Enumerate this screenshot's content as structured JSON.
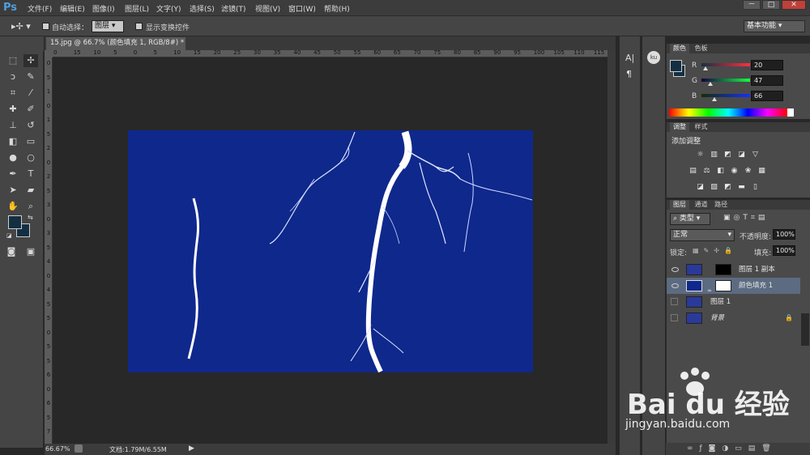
{
  "app": {
    "logo": "Ps"
  },
  "menu": [
    "文件(F)",
    "编辑(E)",
    "图像(I)",
    "图层(L)",
    "文字(Y)",
    "选择(S)",
    "滤镜(T)",
    "视图(V)",
    "窗口(W)",
    "帮助(H)"
  ],
  "window_buttons": [
    "－",
    "□",
    "✕"
  ],
  "options": {
    "auto_select_label": "自动选择：",
    "auto_select_target": "图层",
    "show_transform_label": "显示变换控件",
    "workspace": "基本功能"
  },
  "document": {
    "tab_title": "15.jpg @ 66.7% (颜色填充 1, RGB/8#) *",
    "tab_close": "×",
    "fill_color": "#0f288c"
  },
  "ruler": {
    "h_ticks": [
      "0",
      "15",
      "10",
      "5",
      "0",
      "5",
      "10",
      "15",
      "20",
      "25",
      "30",
      "35",
      "40",
      "45",
      "50",
      "55",
      "60",
      "65",
      "70",
      "75",
      "80",
      "85",
      "90",
      "95",
      "100",
      "105",
      "110",
      "115"
    ],
    "v_ticks": [
      "0",
      "5",
      "1",
      "0",
      "1",
      "5",
      "2",
      "0",
      "2",
      "5",
      "3",
      "0",
      "3",
      "5",
      "4",
      "0",
      "4",
      "5",
      "5",
      "0",
      "5",
      "5",
      "6",
      "0",
      "6",
      "5",
      "7"
    ]
  },
  "status": {
    "zoom": "66.67%",
    "doc_size": "文档:1.79M/6.55M"
  },
  "color_panel": {
    "tabs": [
      "颜色",
      "色板"
    ],
    "r_label": "R",
    "g_label": "G",
    "b_label": "B",
    "r": "20",
    "g": "47",
    "b": "66",
    "r_level": 0.078,
    "g_level": 0.184,
    "b_level": 0.259,
    "swatch": "#142f42"
  },
  "adjustments_panel": {
    "tabs": [
      "调整",
      "样式"
    ],
    "title": "添加调整"
  },
  "layers_panel": {
    "tabs": [
      "图层",
      "通道",
      "路径"
    ],
    "filter_kind": "类型",
    "blend_mode": "正常",
    "opacity_label": "不透明度:",
    "opacity_value": "100%",
    "lock_label": "锁定:",
    "fill_label": "填充:",
    "fill_value": "100%",
    "layers": [
      {
        "name": "图层 1 副本",
        "visible": true
      },
      {
        "name": "颜色填充 1",
        "visible": true,
        "selected": true
      },
      {
        "name": "图层 1",
        "visible": false
      },
      {
        "name": "背景",
        "visible": false,
        "locked": true
      }
    ]
  },
  "watermark": {
    "brand": "Bai du 经验",
    "url": "jingyan.baidu.com"
  },
  "icons": {
    "ps-logo": "ps-logo",
    "move": "move-tool-icon",
    "marquee": "marquee-tool-icon",
    "lasso": "lasso-tool-icon",
    "crop": "crop-tool-icon",
    "brush": "brush-tool-icon",
    "text": "text-tool-icon",
    "hand": "hand-tool-icon",
    "zoom": "zoom-tool-icon"
  }
}
